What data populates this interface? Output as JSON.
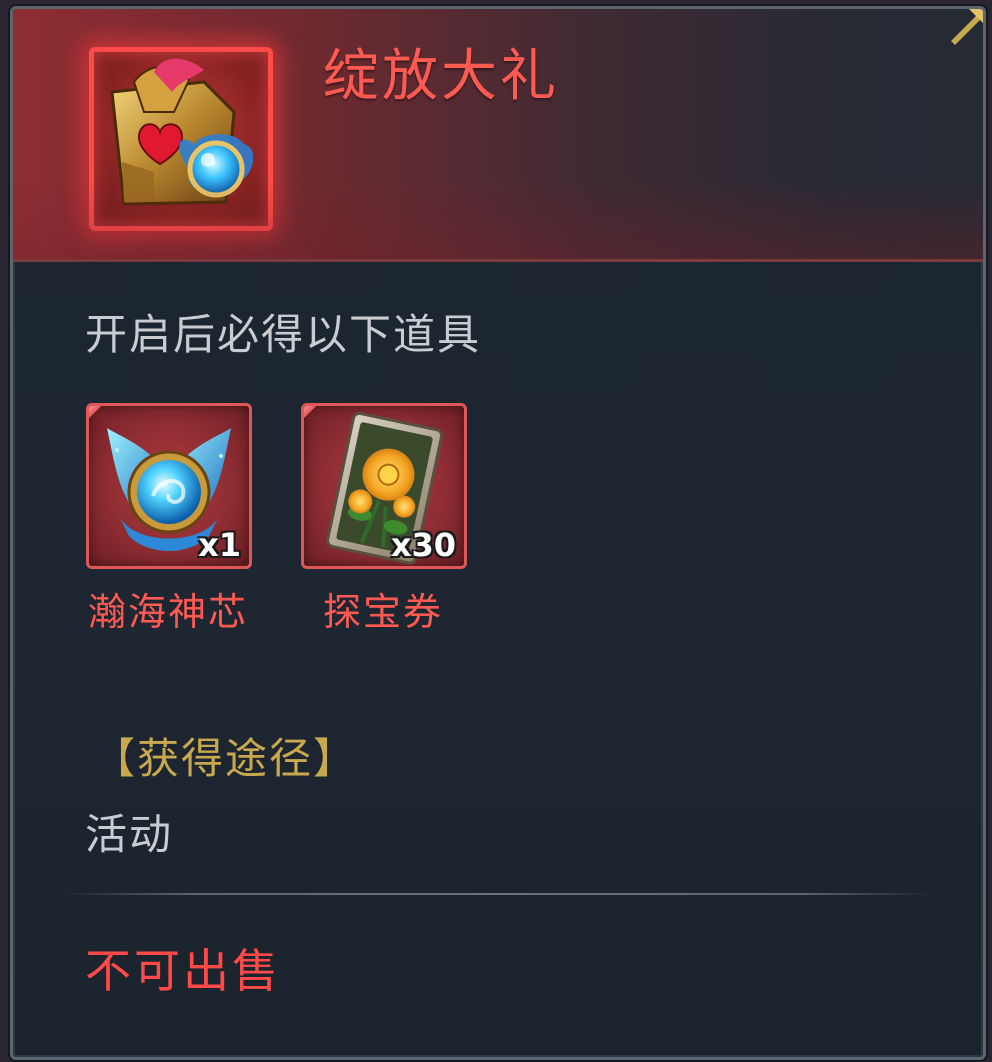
{
  "item": {
    "title": "绽放大礼",
    "icon": "gift-chest-icon"
  },
  "contents": {
    "description": "开启后必得以下道具",
    "rewards": [
      {
        "name": "瀚海神芯",
        "quantity": "x1",
        "icon": "blue-orb-core-icon"
      },
      {
        "name": "探宝券",
        "quantity": "x30",
        "icon": "flower-card-icon"
      }
    ]
  },
  "source": {
    "heading": "【获得途径】",
    "value": "活动"
  },
  "sale_status": "不可出售",
  "colors": {
    "title_red": "#ff5a52",
    "gold": "#c9a94e",
    "panel_bg": "#1c2530",
    "header_red": "#8e2d33"
  }
}
